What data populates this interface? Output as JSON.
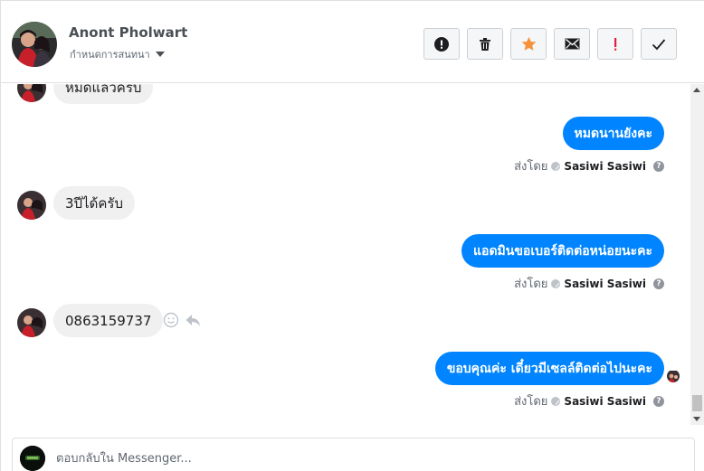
{
  "header": {
    "contact_name": "Anont Pholwart",
    "assign_label": "กำหนดการสนทนา",
    "actions": [
      {
        "name": "mark-spam-button",
        "icon": "alert-circle-icon"
      },
      {
        "name": "delete-button",
        "icon": "trash-icon"
      },
      {
        "name": "star-button",
        "icon": "star-icon",
        "color": "#f7923b"
      },
      {
        "name": "mark-unread-button",
        "icon": "envelope-icon"
      },
      {
        "name": "follow-up-button",
        "icon": "exclamation-icon",
        "color": "#e41e3f"
      },
      {
        "name": "mark-done-button",
        "icon": "check-icon"
      }
    ]
  },
  "thread": {
    "messages": [
      {
        "direction": "in",
        "text": "หมดแล้วครับ"
      },
      {
        "direction": "out",
        "text": "หมดนานยังคะ",
        "sent_by_label": "ส่งโดย",
        "sender": "Sasiwi Sasiwi"
      },
      {
        "direction": "in",
        "text": "3ปีได้ครับ"
      },
      {
        "direction": "out",
        "text": "แอดมินขอเบอร์ติดต่อหน่อยนะคะ",
        "sent_by_label": "ส่งโดย",
        "sender": "Sasiwi Sasiwi"
      },
      {
        "direction": "in",
        "text": "0863159737"
      },
      {
        "direction": "out",
        "text": "ขอบคุณค่ะ เดี๋ยวมีเซลล์ติดต่อไปนะคะ",
        "sent_by_label": "ส่งโดย",
        "sender": "Sasiwi Sasiwi"
      }
    ]
  },
  "composer": {
    "placeholder": "ตอบกลับใน Messenger...",
    "value": ""
  },
  "colors": {
    "accent": "#0084ff",
    "incoming_bubble": "#f1f0f0",
    "star": "#f7923b",
    "alert": "#e41e3f"
  }
}
